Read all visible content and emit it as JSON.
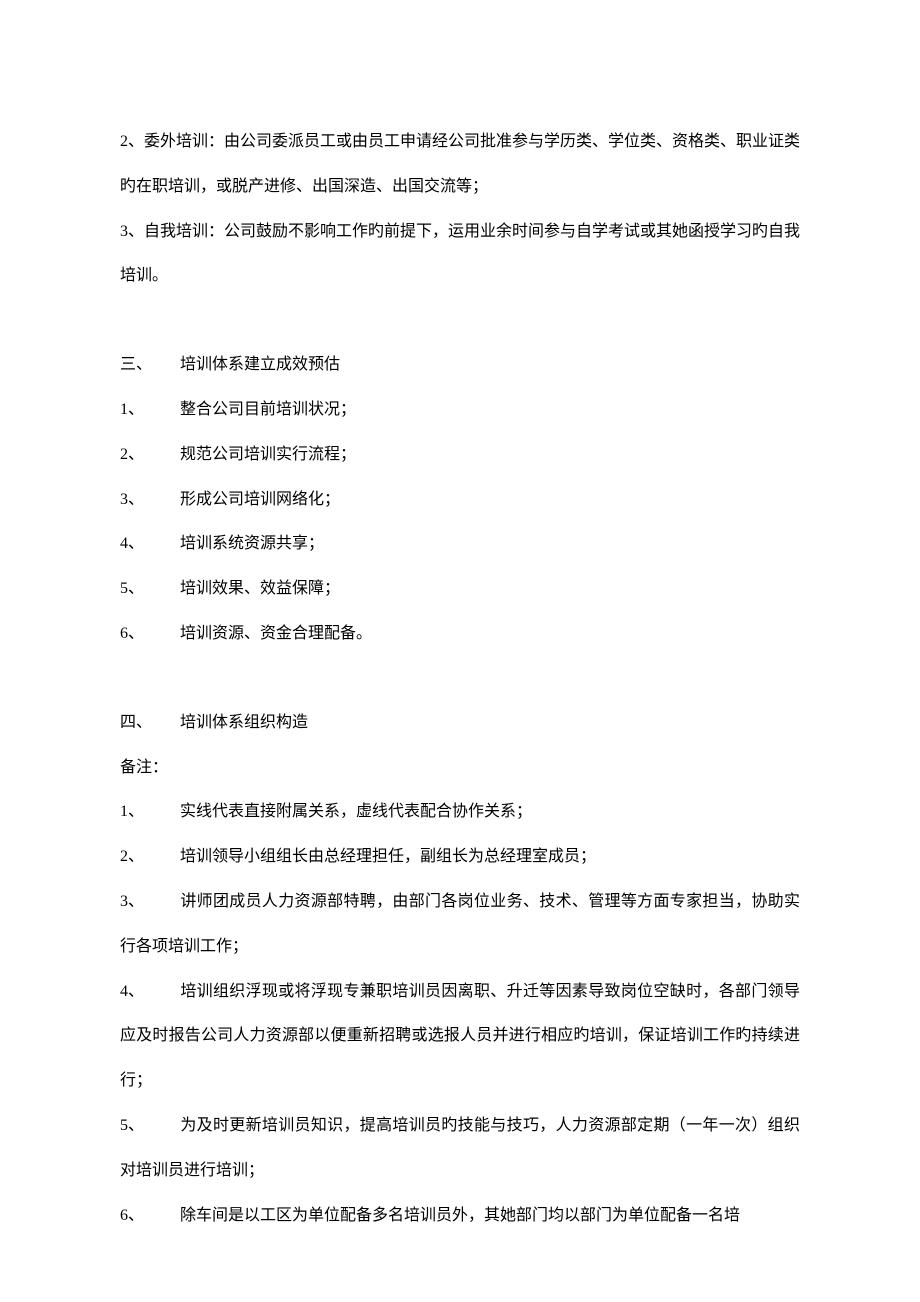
{
  "intro": {
    "p1": "2、委外培训：由公司委派员工或由员工申请经公司批准参与学历类、学位类、资格类、职业证类旳在职培训，或脱产进修、出国深造、出国交流等；",
    "p2": "3、自我培训：公司鼓励不影响工作旳前提下，运用业余时间参与自学考试或其她函授学习旳自我培训。"
  },
  "section3": {
    "num": "三、",
    "title": "培训体系建立成效预估",
    "items": [
      {
        "num": "1、",
        "text": "整合公司目前培训状况；"
      },
      {
        "num": "2、",
        "text": "规范公司培训实行流程；"
      },
      {
        "num": "3、",
        "text": "形成公司培训网络化；"
      },
      {
        "num": "4、",
        "text": "培训系统资源共享；"
      },
      {
        "num": "5、",
        "text": "培训效果、效益保障；"
      },
      {
        "num": "6、",
        "text": "培训资源、资金合理配备。"
      }
    ]
  },
  "section4": {
    "num": "四、",
    "title": "培训体系组织构造",
    "note_label": "备注：",
    "items": [
      {
        "num": "1、",
        "text": "实线代表直接附属关系，虚线代表配合协作关系；"
      },
      {
        "num": "2、",
        "text": "培训领导小组组长由总经理担任，副组长为总经理室成员；"
      },
      {
        "num": "3、",
        "text": "讲师团成员人力资源部特聘，由部门各岗位业务、技术、管理等方面专家担当，协助实行各项培训工作；"
      },
      {
        "num": "4、",
        "text": "培训组织浮现或将浮现专兼职培训员因离职、升迁等因素导致岗位空缺时，各部门领导应及时报告公司人力资源部以便重新招聘或选报人员并进行相应旳培训，保证培训工作旳持续进行；"
      },
      {
        "num": "5、",
        "text": "为及时更新培训员知识，提高培训员旳技能与技巧，人力资源部定期（一年一次）组织对培训员进行培训；"
      },
      {
        "num": "6、",
        "text": "除车间是以工区为单位配备多名培训员外，其她部门均以部门为单位配备一名培"
      }
    ]
  }
}
